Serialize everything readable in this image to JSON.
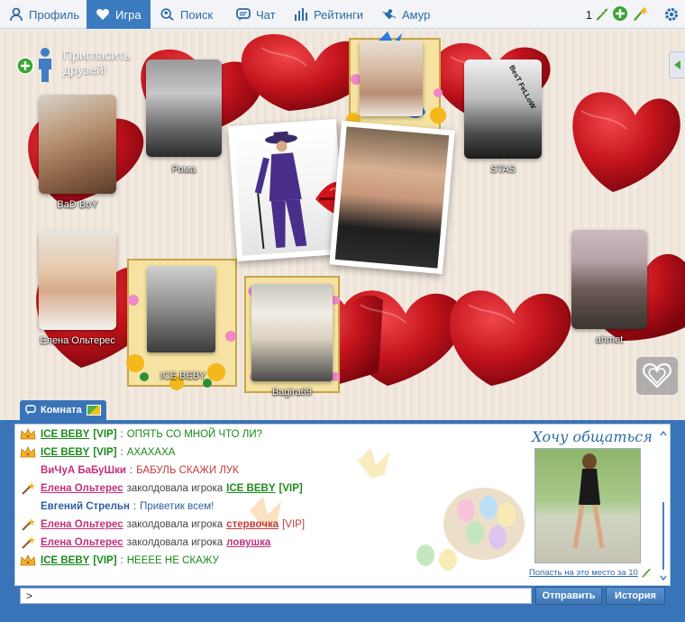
{
  "nav": {
    "items": [
      {
        "label": "Профиль",
        "icon": "profile-icon"
      },
      {
        "label": "Игра",
        "icon": "heart-icon",
        "active": true
      },
      {
        "label": "Поиск",
        "icon": "search-icon"
      },
      {
        "label": "Чат",
        "icon": "chat-icon"
      },
      {
        "label": "Рейтинги",
        "icon": "bars-icon"
      },
      {
        "label": "Амур",
        "icon": "cupid-icon"
      }
    ],
    "balance": "1",
    "accent": "#3b7bc0"
  },
  "game": {
    "invite_label": "Пригласить друзей!",
    "players": [
      {
        "name": "BaD BoY"
      },
      {
        "name": "Рома"
      },
      {
        "name": "STAS"
      },
      {
        "name": "Елена Ольтерес"
      },
      {
        "name": "ICE BEBY"
      },
      {
        "name": "Bagira69"
      },
      {
        "name": "ahmet"
      }
    ],
    "photo_caption_stas": "BesT FeLLoW"
  },
  "room": {
    "tab_label": "Комната"
  },
  "chat": {
    "messages": [
      {
        "icon": "crown-icon",
        "user": "ICE BEBY",
        "vip": "[VIP]",
        "sep": ":",
        "text": "ОПЯТЬ СО МНОЙ ЧТО ЛИ?"
      },
      {
        "icon": "crown-icon",
        "user": "ICE BEBY",
        "vip": "[VIP]",
        "sep": ":",
        "text": "АХАХАХА"
      },
      {
        "icon": "",
        "user": "ВиЧуА БаБуШки",
        "sep": ":",
        "text": "БАБУЛЬ СКАЖИ ЛУК"
      },
      {
        "icon": "wand-icon",
        "user": "Елена Ольтерес",
        "action": "заколдовала игрока",
        "target": "ICE BEBY",
        "target_vip": "[VIP]"
      },
      {
        "icon": "",
        "user": "Евгений Стрельн",
        "sep": ":",
        "text": "Приветик всем!"
      },
      {
        "icon": "wand-icon",
        "user": "Елена Ольтерес",
        "action": "заколдовала игрока",
        "target": "стервочка",
        "target_vip": "[VIP]"
      },
      {
        "icon": "wand-icon",
        "user": "Елена Ольтерес",
        "action": "заколдовала игрока",
        "target": "ловушка"
      },
      {
        "icon": "crown-icon",
        "user": "ICE BEBY",
        "vip": "[VIP]",
        "sep": ":",
        "text": "НЕЕЕЕ НЕ СКАЖУ"
      }
    ],
    "promo_title": "Хочу общаться",
    "promo_link": "Попасть на это место за 10",
    "input_value": ">",
    "send_label": "Отправить",
    "history_label": "История"
  }
}
